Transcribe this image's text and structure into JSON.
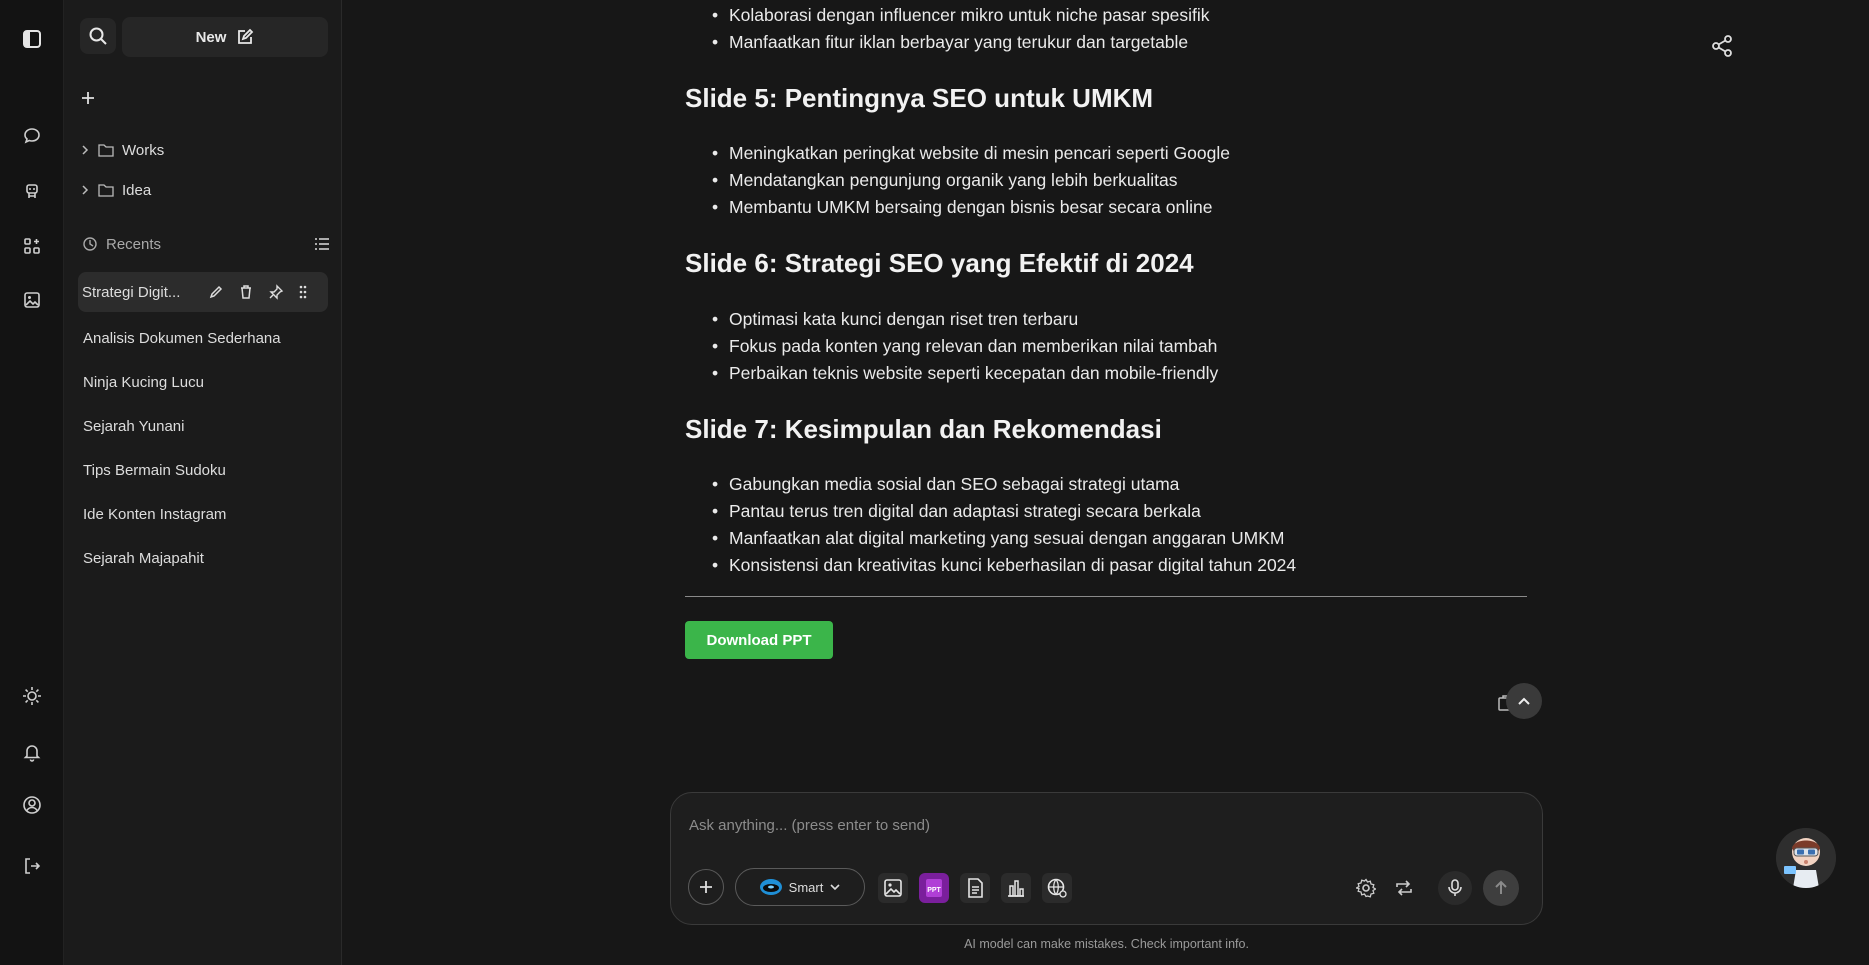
{
  "sidebar": {
    "new_label": "New",
    "folders": [
      {
        "label": "Works"
      },
      {
        "label": "Idea"
      }
    ],
    "recents_title": "Recents",
    "recents": [
      {
        "label": "Strategi Digit..."
      },
      {
        "label": "Analisis Dokumen Sederhana"
      },
      {
        "label": "Ninja Kucing Lucu"
      },
      {
        "label": "Sejarah Yunani"
      },
      {
        "label": "Tips Bermain Sudoku"
      },
      {
        "label": "Ide Konten Instagram"
      },
      {
        "label": "Sejarah Majapahit"
      }
    ]
  },
  "content": {
    "top_bullets": [
      "Kolaborasi dengan influencer mikro untuk niche pasar spesifik",
      "Manfaatkan fitur iklan berbayar yang terukur dan targetable"
    ],
    "slides": [
      {
        "heading": "Slide 5: Pentingnya SEO untuk UMKM",
        "bullets": [
          "Meningkatkan peringkat website di mesin pencari seperti Google",
          "Mendatangkan pengunjung organik yang lebih berkualitas",
          "Membantu UMKM bersaing dengan bisnis besar secara online"
        ]
      },
      {
        "heading": "Slide 6: Strategi SEO yang Efektif di 2024",
        "bullets": [
          "Optimasi kata kunci dengan riset tren terbaru",
          "Fokus pada konten yang relevan dan memberikan nilai tambah",
          "Perbaikan teknis website seperti kecepatan dan mobile-friendly"
        ]
      },
      {
        "heading": "Slide 7: Kesimpulan dan Rekomendasi",
        "bullets": [
          "Gabungkan media sosial dan SEO sebagai strategi utama",
          "Pantau terus tren digital dan adaptasi strategi secara berkala",
          "Manfaatkan alat digital marketing yang sesuai dengan anggaran UMKM",
          "Konsistensi dan kreativitas kunci keberhasilan di pasar digital tahun 2024"
        ]
      }
    ],
    "download_label": "Download PPT"
  },
  "chat": {
    "placeholder": "Ask anything... (press enter to send)",
    "model_label": "Smart",
    "ppt_icon_text": "PPT",
    "disclaimer": "AI model can make mistakes. Check important info."
  },
  "colors": {
    "background": "#171717",
    "sidebar": "#1b1b1b",
    "accent_green": "#3bb54a",
    "ppt_purple": "#7a1f9c"
  },
  "icons": {
    "rail": [
      "sidebar-toggle-icon",
      "chat-icon",
      "robot-icon",
      "apps-icon",
      "image-icon",
      "sun-icon",
      "bell-icon",
      "user-icon",
      "logout-icon"
    ],
    "chat_tools": [
      "image-tool-icon",
      "ppt-tool-icon",
      "document-tool-icon",
      "chart-tool-icon",
      "web-search-icon"
    ],
    "chat_right": [
      "settings-icon",
      "repeat-icon",
      "microphone-icon",
      "send-arrow-icon"
    ]
  }
}
